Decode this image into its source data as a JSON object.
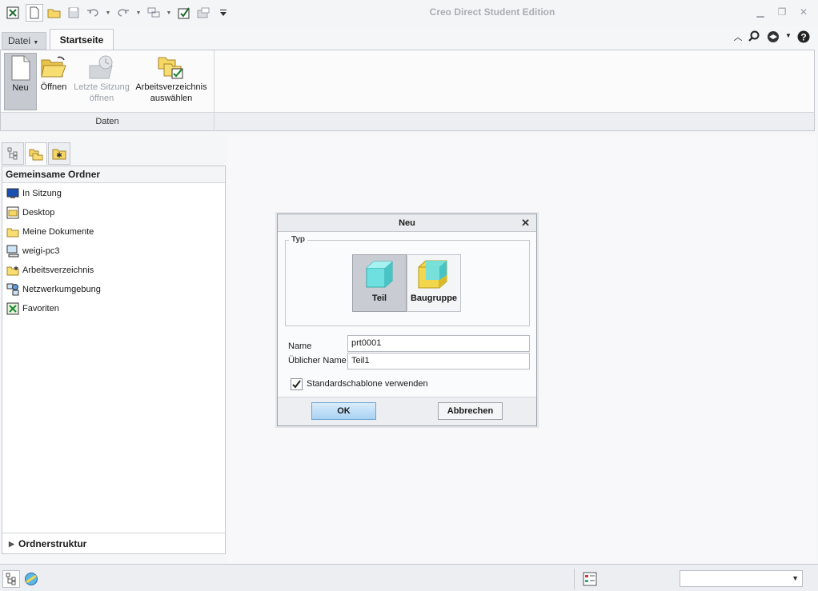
{
  "app_title": "Creo Direct Student Edition",
  "ribbon": {
    "tabs": {
      "file_label": "Datei",
      "home_label": "Startseite"
    },
    "buttons": {
      "new_label": "Neu",
      "open_label": "Öffnen",
      "last_session_line1": "Letzte Sitzung",
      "last_session_line2": "öffnen",
      "select_dir_line1": "Arbeitsverzeichnis",
      "select_dir_line2": "auswählen"
    },
    "group_label": "Daten"
  },
  "navigator": {
    "header": "Gemeinsame Ordner",
    "folders": [
      {
        "label": "In Sitzung",
        "icon": "session-icon"
      },
      {
        "label": "Desktop",
        "icon": "desktop-icon"
      },
      {
        "label": "Meine Dokumente",
        "icon": "documents-folder-icon"
      },
      {
        "label": "weigi-pc3",
        "icon": "computer-icon"
      },
      {
        "label": "Arbeitsverzeichnis",
        "icon": "working-directory-icon"
      },
      {
        "label": "Netzwerkumgebung",
        "icon": "network-icon"
      },
      {
        "label": "Favoriten",
        "icon": "favorites-icon"
      }
    ],
    "footer": "Ordnerstruktur"
  },
  "dialog": {
    "title": "Neu",
    "type_group_label": "Typ",
    "types": [
      {
        "label": "Teil",
        "selected": true
      },
      {
        "label": "Baugruppe",
        "selected": false
      }
    ],
    "name_label": "Name",
    "name_value": "prt0001",
    "common_name_label": "Üblicher Name",
    "common_name_value": "Teil1",
    "template_checkbox_label": "Standardschablone verwenden",
    "template_checked": true,
    "ok_label": "OK",
    "cancel_label": "Abbrechen"
  },
  "colors": {
    "accent_ok": "#a9d2f3",
    "part_cube": "#6fe0e0",
    "assembly_cube": "#f2d64b"
  }
}
